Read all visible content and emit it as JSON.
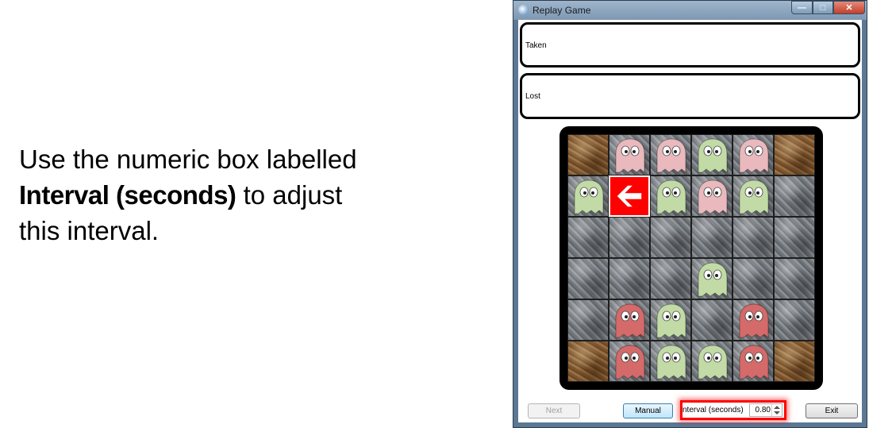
{
  "caption": {
    "line1": "Use the numeric box labelled",
    "line2_bold": "Interval (seconds)",
    "line2_rest": " to adjust",
    "line3": "this interval."
  },
  "window": {
    "title": "Replay Game",
    "buttons": {
      "minimize": "—",
      "maximize": "□",
      "close": "✕"
    }
  },
  "panels": {
    "taken_label": "Taken",
    "lost_label": "Lost"
  },
  "board": {
    "rows": [
      [
        "dirt",
        "pink",
        "pink",
        "green",
        "pink",
        "dirt"
      ],
      [
        "green",
        "arrow-left",
        "green",
        "pink",
        "green",
        "stone"
      ],
      [
        "stone",
        "stone",
        "stone",
        "stone",
        "stone",
        "stone"
      ],
      [
        "stone",
        "stone",
        "stone",
        "green",
        "stone",
        "stone"
      ],
      [
        "stone",
        "red",
        "green",
        "stone",
        "red",
        "stone"
      ],
      [
        "dirt",
        "red",
        "green",
        "green",
        "red",
        "dirt"
      ]
    ],
    "colors": {
      "pink": "#e9b9bd",
      "green": "#c2dba6",
      "red": "#d46a6a",
      "arrow": "#ff0000"
    }
  },
  "controls": {
    "next_label": "Next",
    "manual_label": "Manual",
    "interval_label": "nterval (seconds)",
    "interval_value": "0.80",
    "exit_label": "Exit"
  },
  "highlight_color": "#ff0000"
}
